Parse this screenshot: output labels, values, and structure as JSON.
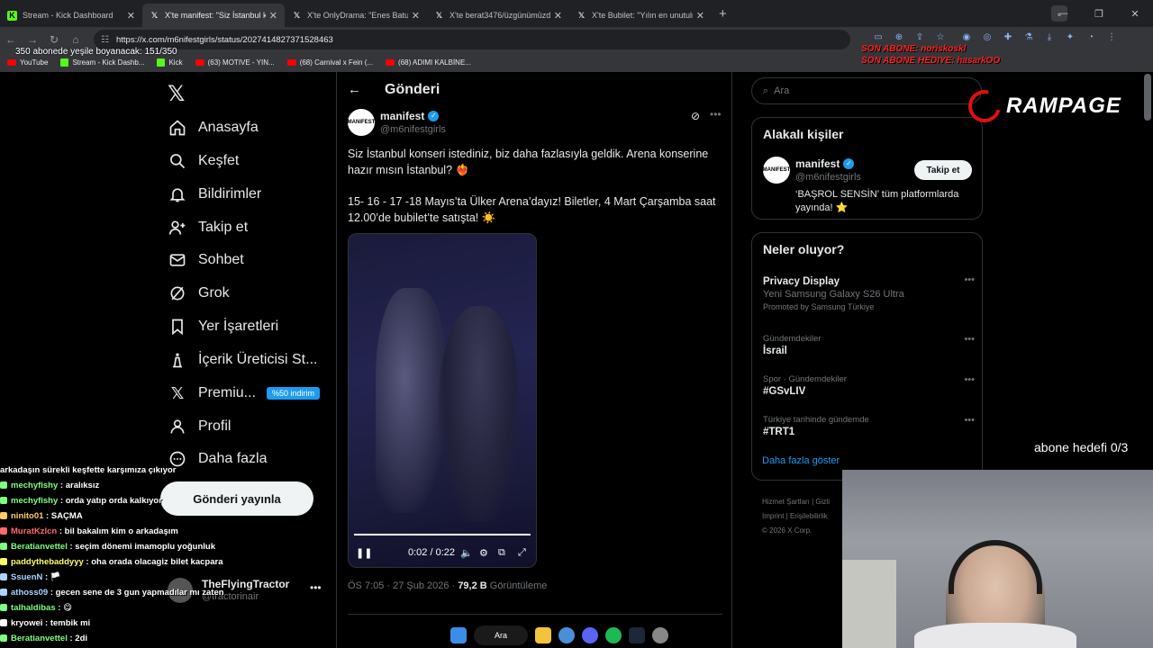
{
  "browser": {
    "tabs": [
      {
        "title": "Stream - Kick Dashboard",
        "icon": "kick-icon"
      },
      {
        "title": "X'te manifest: \"Siz İstanbul k",
        "icon": "x-icon"
      },
      {
        "title": "X'te OnlyDrama: \"Enes Batur'un",
        "icon": "x-icon"
      },
      {
        "title": "X'te berat3476/üzgünümüzdü",
        "icon": "x-icon"
      },
      {
        "title": "X'te Bubilet: \"Yılın en unutulma",
        "icon": "x-icon"
      }
    ],
    "url": "https://x.com/m6nifestgirls/status/2027414827371528463",
    "bookmarks": [
      "YouTube",
      "Stream - Kick Dashb...",
      "Kick",
      "(63) MOTIVE - YIN...",
      "(68) Carnival x Fein (...",
      "(68) ADIMI KALBİNE..."
    ]
  },
  "overlay": {
    "sub_goal_top": "350 abonede yeşile boyanacak: 151/350",
    "red_line1": "SON ABONE: noriskoskl",
    "red_line2": "SON ABONE HEDIYE: hasarkOO",
    "brand": "RAMPAGE",
    "abone_hedef": "abone hedefi 0/3"
  },
  "nav": {
    "items": [
      {
        "label": "Anasayfa",
        "icon": "home-icon"
      },
      {
        "label": "Keşfet",
        "icon": "search-icon"
      },
      {
        "label": "Bildirimler",
        "icon": "bell-icon"
      },
      {
        "label": "Takip et",
        "icon": "add-person-icon"
      },
      {
        "label": "Sohbet",
        "icon": "mail-icon"
      },
      {
        "label": "Grok",
        "icon": "grok-icon"
      },
      {
        "label": "Yer İşaretleri",
        "icon": "bookmark-icon"
      },
      {
        "label": "İçerik Üreticisi St...",
        "icon": "creator-icon"
      },
      {
        "label": "Premiu...",
        "icon": "x-premium-icon"
      },
      {
        "label": "Profil",
        "icon": "profile-icon"
      },
      {
        "label": "Daha fazla",
        "icon": "more-icon"
      }
    ],
    "premium_badge": "%50 indirim",
    "post_button": "Gönderi yayınla",
    "account": {
      "name": "TheFlyingTractor",
      "handle": "@tractorinair"
    }
  },
  "post": {
    "header": "Gönderi",
    "author_name": "manifest",
    "author_handle": "@m6nifestgirls",
    "avatar_text": "MANIFEST",
    "text1": "Siz İstanbul konseri istediniz, biz daha fazlasıyla geldik. Arena konserine hazır mısın İstanbul? ❤️‍🔥",
    "text2": "15- 16 - 17 -18 Mayıs’ta Ülker Arena’dayız! Biletler, 4 Mart Çarşamba saat 12.00’de bubilet’te satışta! ☀️",
    "video_time": "0:02 / 0:22",
    "video_progress": 1.0,
    "timestamp": "ÖS 7:05 · 27 Şub 2026 · ",
    "views": "79,2 B",
    "views_label": " Görüntüleme"
  },
  "sidebar": {
    "search_placeholder": "Ara",
    "related_title": "Alakalı kişiler",
    "related": {
      "name": "manifest",
      "handle": "@m6nifestgirls",
      "bio": "‘BAŞROL SENSİN’ tüm platformlarda yayında! ⭐",
      "follow_label": "Takip et"
    },
    "trends_title": "Neler oluyor?",
    "trends": [
      {
        "category": "",
        "title": "Privacy Display",
        "sub": "Yeni Samsung Galaxy S26 Ultra",
        "promo": "Promoted by Samsung Türkiye"
      },
      {
        "category": "Gündemdekiler",
        "title": "İsrail",
        "sub": "",
        "promo": ""
      },
      {
        "category": "Spor · Gündemdekiler",
        "title": "#GSvLIV",
        "sub": "",
        "promo": ""
      },
      {
        "category": "Türkiye tarihinde gündemde",
        "title": "#TRT1",
        "sub": "",
        "promo": ""
      }
    ],
    "show_more": "Daha fazla göster",
    "footer": [
      "Hizmet Şartları | Gizli",
      "Imprint | Erişilebilirlik",
      "© 2026 X Corp."
    ]
  },
  "chat": [
    {
      "user": "",
      "msg": "arkadaşın sürekli keşfette karşımıza çıkıyor",
      "color": "#ffffff"
    },
    {
      "user": "mechyfishy",
      "msg": " : aralıksız",
      "color": "#7fff7f"
    },
    {
      "user": "mechyfishy",
      "msg": " : orda yatıp orda kalkıyor",
      "color": "#7fff7f"
    },
    {
      "user": "ninito01",
      "msg": " : SAÇMA",
      "color": "#ffcc66"
    },
    {
      "user": "MuratKzlcn",
      "msg": " : bil bakalım kim o arkadaşım",
      "color": "#ff6b6b"
    },
    {
      "user": "Beratianvettel",
      "msg": " : seçim dönemi imamoplu yoğunluk",
      "color": "#7fff7f"
    },
    {
      "user": "paddythebaddyyy",
      "msg": " : oha orada olacagiz bilet kacpara",
      "color": "#ffff66"
    },
    {
      "user": "SsuenN",
      "msg": " : 🏳️",
      "color": "#aad4ff"
    },
    {
      "user": "athoss09",
      "msg": " : gecen sene de 3 gun yapmadılar mı zaten",
      "color": "#aad4ff"
    },
    {
      "user": "talhaldibas",
      "msg": " : 😋",
      "color": "#7fff7f"
    },
    {
      "user": "kryowei",
      "msg": " : tembik mi",
      "color": "#ffffff"
    },
    {
      "user": "Beratianvettel",
      "msg": " : 2di",
      "color": "#7fff7f"
    }
  ],
  "taskbar": {
    "search_label": "Ara"
  }
}
